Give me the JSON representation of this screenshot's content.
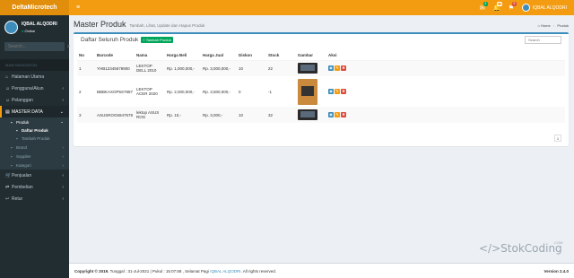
{
  "app": {
    "logo": "DeltaMicrotech"
  },
  "navbar": {
    "menu_icon": "≡",
    "icons": [
      {
        "name": "envelope-icon",
        "glyph": "✉",
        "badge": "4"
      },
      {
        "name": "bell-icon",
        "glyph": "🔔",
        "badge": "10"
      },
      {
        "name": "flag-icon",
        "glyph": "⚑",
        "badge": "9"
      }
    ],
    "user_name": "IQBAL ALQODRI"
  },
  "sidebar": {
    "user_name": "IQBAL ALQODRI",
    "user_status": "Online",
    "search_placeholder": "Search...",
    "section_header": "MAIN NAVIGATION",
    "items": [
      {
        "label": "Halaman Utama",
        "icon": "⌂"
      },
      {
        "label": "Pengguna/Akun",
        "icon": "☺",
        "chevron": "‹"
      },
      {
        "label": "Pelanggan",
        "icon": "☺",
        "chevron": "‹"
      },
      {
        "label": "MASTER DATA",
        "icon": "▤",
        "chevron": "⌄"
      }
    ],
    "master_sub": [
      {
        "label": "Produk",
        "icon": "▪",
        "chevron": "⌄"
      },
      {
        "label": "Daftar Produk",
        "icon": "▪"
      },
      {
        "label": "Tambah Produk",
        "icon": "▪"
      },
      {
        "label": "Brand",
        "icon": "▪",
        "chevron": "‹"
      },
      {
        "label": "Supplier",
        "icon": "▪",
        "chevron": "‹"
      },
      {
        "label": "Kategori",
        "icon": "▪",
        "chevron": "‹"
      }
    ],
    "items2": [
      {
        "label": "Penjualan",
        "icon": "🛒",
        "chevron": "‹"
      },
      {
        "label": "Pembelian",
        "icon": "⇄",
        "chevron": "‹"
      },
      {
        "label": "Retur",
        "icon": "↩",
        "chevron": "‹"
      }
    ]
  },
  "header": {
    "title": "Master Produk",
    "subtitle": "Tambah, Lihat, Update dan Hapus Produk",
    "breadcrumb": [
      "Home",
      "Produk"
    ]
  },
  "box": {
    "title": "Daftar Seluruh Produk",
    "add_button": "+ Tambah Produk",
    "search_placeholder": "Search",
    "columns": [
      "No",
      "Barcode",
      "Nama",
      "Harga Beli",
      "Harga Jual",
      "Diskon",
      "Stock",
      "Gambar",
      "Aksi"
    ],
    "rows": [
      {
        "no": "1",
        "barcode": "YHB12345678900",
        "nama": "LEKTOP DELL 2010",
        "harga_beli": "Rp. 1,000,000,-",
        "harga_jual": "Rp. 3,000,000,-",
        "diskon": "10",
        "stock": "22"
      },
      {
        "no": "2",
        "barcode": "BBBKAXOP5S7887",
        "nama": "LEKTOP ACER 2020",
        "harga_beli": "Rp. 2,000,000,-",
        "harga_jual": "Rp. 3,500,000,-",
        "diskon": "0",
        "stock": "-1"
      },
      {
        "no": "3",
        "barcode": "ASUSROG5947578",
        "nama": "lektop ASUS ROG",
        "harga_beli": "Rp. 10,-",
        "harga_jual": "Rp. 3,000,-",
        "diskon": "10",
        "stock": "32"
      }
    ],
    "actions": {
      "view": "◉",
      "edit": "✎",
      "delete": "✖"
    },
    "page": "1"
  },
  "watermark": {
    "text": "</>StokCoding",
    "suffix": ".COM"
  },
  "footer": {
    "copyright": "Copyright © 2019.",
    "info": "Tunggal : 31-Jul-2021 | Pukul : 15:07:58 , Selamat Pagi",
    "user": "IQBAL ALQODRI",
    "rights": ". All rights reserved.",
    "version": "Version 2.4.0"
  }
}
